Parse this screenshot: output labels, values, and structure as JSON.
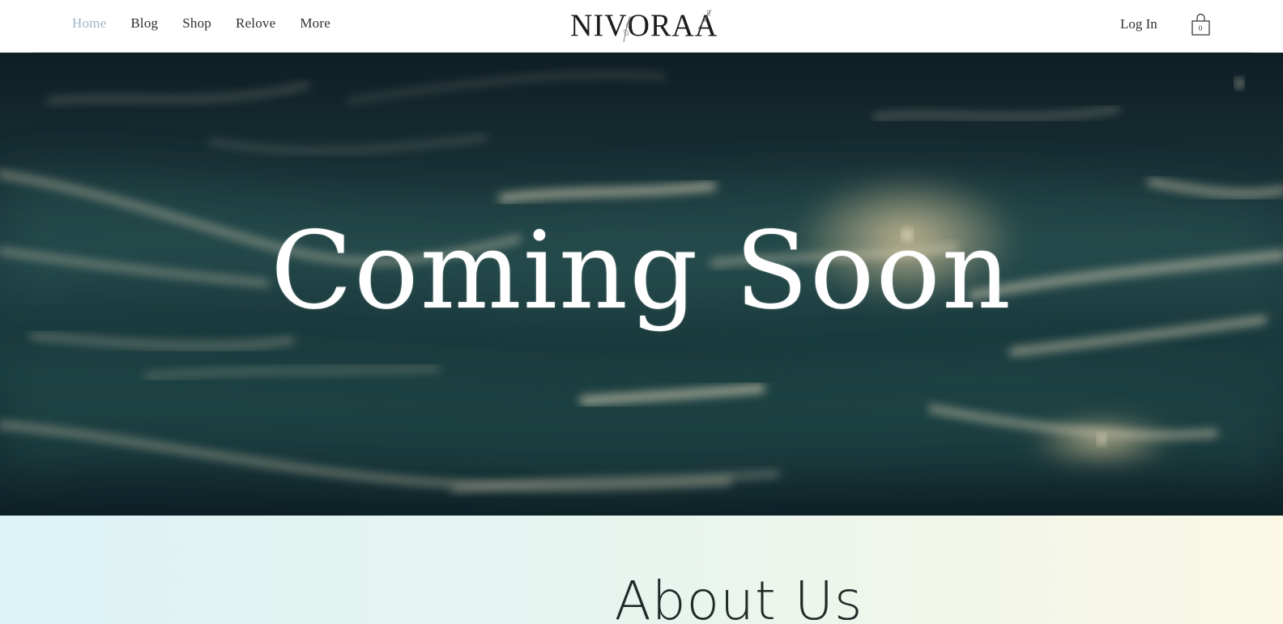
{
  "header": {
    "nav": [
      {
        "label": "Home",
        "active": true
      },
      {
        "label": "Blog",
        "active": false
      },
      {
        "label": "Shop",
        "active": false
      },
      {
        "label": "Relove",
        "active": false
      },
      {
        "label": "More",
        "active": false
      }
    ],
    "logo_text": "NIVORAA",
    "login_label": "Log In",
    "cart_count": "0",
    "cart_icon": "shopping-bag-icon"
  },
  "hero": {
    "title": "Coming Soon"
  },
  "about": {
    "title": "About Us"
  },
  "colors": {
    "active_nav": "#9fb5c9",
    "text": "#2e2e2e",
    "hero_dark": "#0c1a20",
    "hero_highlight": "#e9dcc0"
  }
}
